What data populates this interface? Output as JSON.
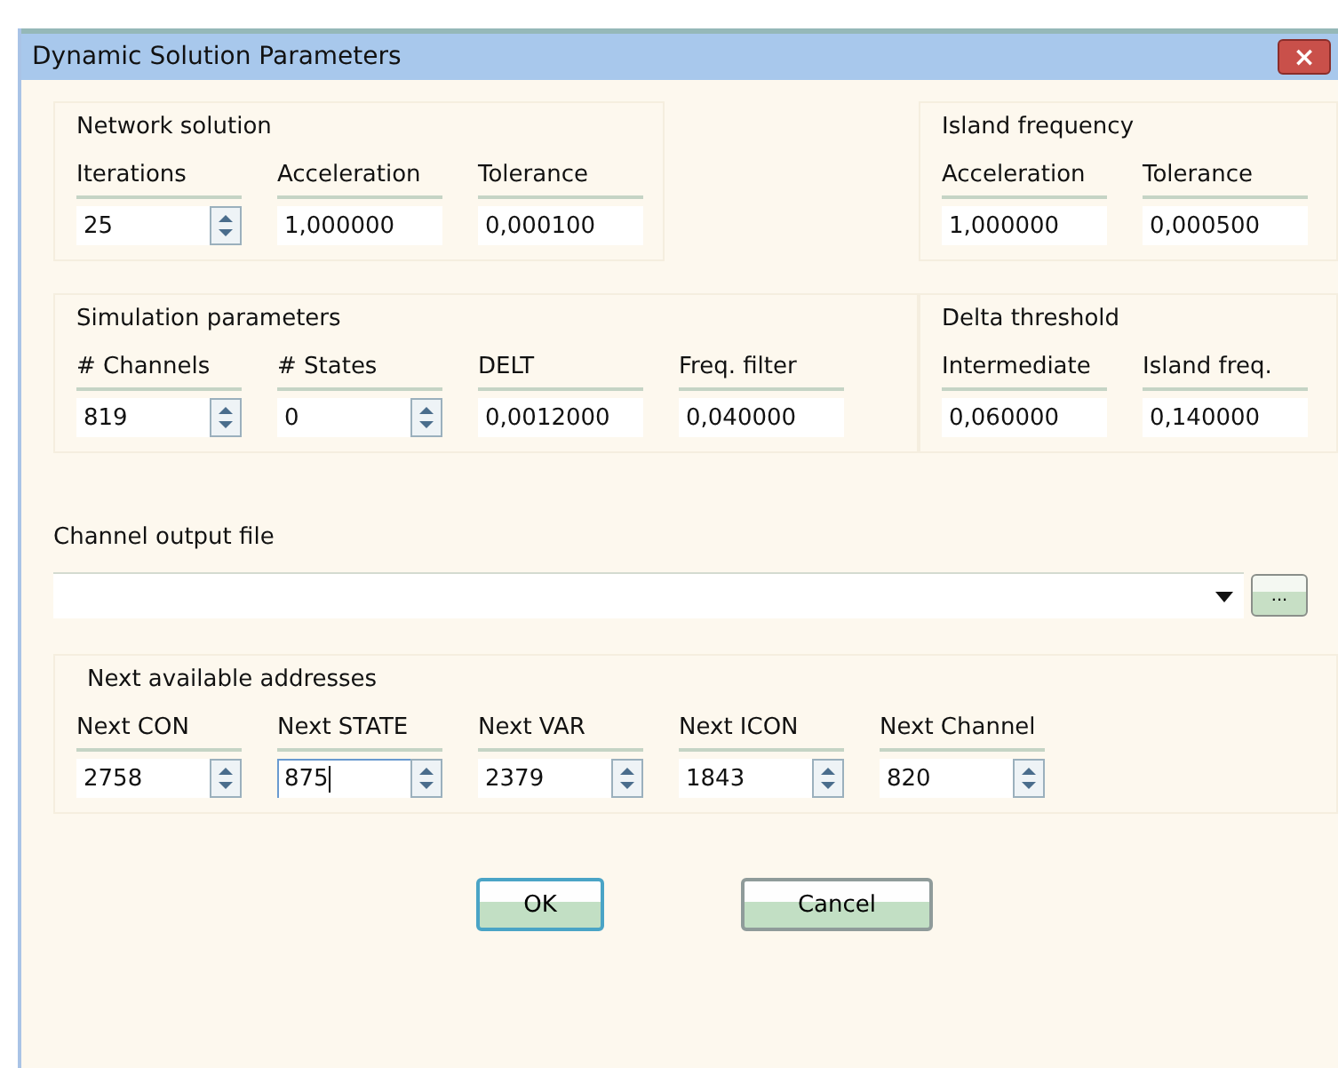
{
  "window": {
    "title": "Dynamic Solution Parameters",
    "close": "×"
  },
  "top_groups": [
    {
      "title": "Network solution",
      "fields": [
        {
          "label": "Iterations",
          "value": "25",
          "kind": "spin",
          "focused": false
        },
        {
          "label": "Acceleration",
          "value": "1,000000",
          "kind": "text",
          "focused": false
        },
        {
          "label": "Tolerance",
          "value": "0,000100",
          "kind": "text",
          "focused": false
        }
      ]
    },
    {
      "title": "Island frequency",
      "fields": [
        {
          "label": "Acceleration",
          "value": "1,000000",
          "kind": "text",
          "focused": false
        },
        {
          "label": "Tolerance",
          "value": "0,000500",
          "kind": "text",
          "focused": false
        }
      ]
    },
    {
      "title": "Simulation parameters",
      "fields": [
        {
          "label": "# Channels",
          "value": "819",
          "kind": "spin",
          "focused": false
        },
        {
          "label": "# States",
          "value": "0",
          "kind": "spin",
          "focused": false
        },
        {
          "label": "DELT",
          "value": "0,0012000",
          "kind": "text",
          "focused": false
        },
        {
          "label": "Freq. filter",
          "value": "0,040000",
          "kind": "text",
          "focused": false
        }
      ]
    },
    {
      "title": "Delta threshold",
      "fields": [
        {
          "label": "Intermediate",
          "value": "0,060000",
          "kind": "text",
          "focused": false
        },
        {
          "label": "Island freq.",
          "value": "0,140000",
          "kind": "text",
          "focused": false
        }
      ]
    }
  ],
  "channel_output": {
    "label": "Channel output file",
    "browse": "..."
  },
  "addresses": {
    "title": "Next available addresses",
    "fields": [
      {
        "label": "Next CON",
        "value": "2758",
        "kind": "spin",
        "focused": false
      },
      {
        "label": "Next STATE",
        "value": "875",
        "kind": "spin",
        "focused": true
      },
      {
        "label": "Next VAR",
        "value": "2379",
        "kind": "spin",
        "focused": false
      },
      {
        "label": "Next ICON",
        "value": "1843",
        "kind": "spin",
        "focused": false
      },
      {
        "label": "Next Channel",
        "value": "820",
        "kind": "spin",
        "focused": false
      }
    ]
  },
  "buttons": [
    {
      "label": "OK",
      "default": true
    },
    {
      "label": "Cancel",
      "default": false
    }
  ]
}
